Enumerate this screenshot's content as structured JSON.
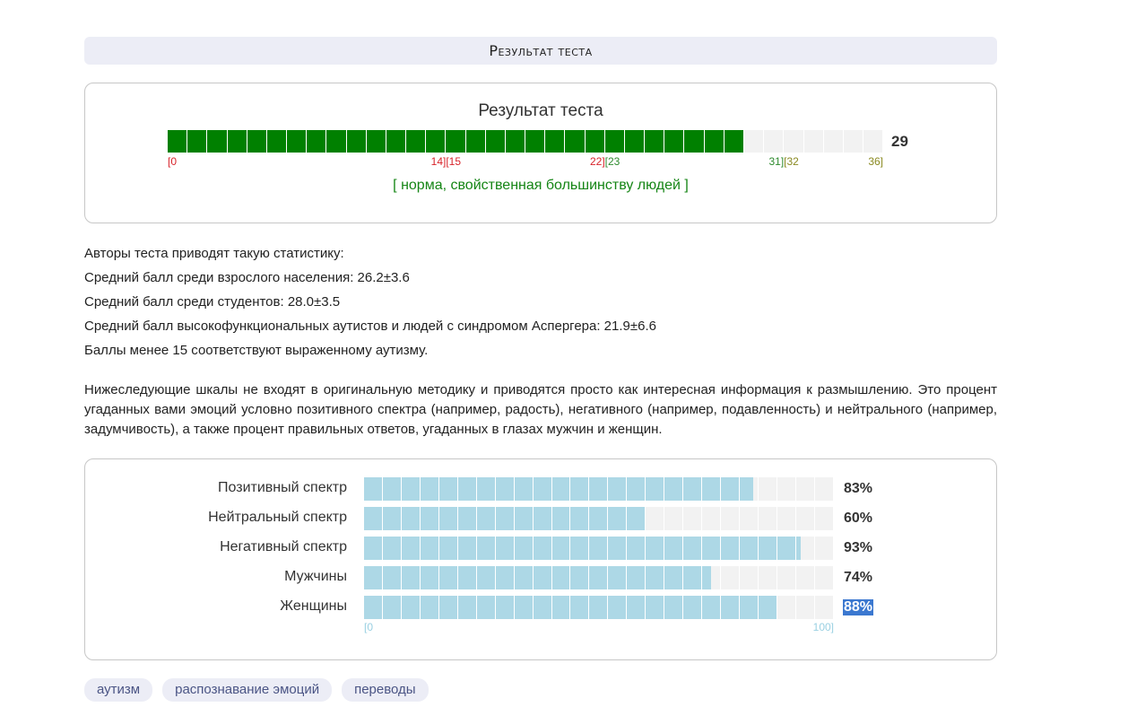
{
  "header": {
    "title": "Результат теста"
  },
  "main_result": {
    "title": "Результат теста",
    "value": 29,
    "max": 36,
    "value_label": "29",
    "fill_color": "#008000",
    "empty_color": "#f2f2f2",
    "ticks": [
      {
        "pos": 0,
        "text": "[0",
        "color": "#d8242b",
        "align": "left"
      },
      {
        "pos": 14,
        "text": "14]",
        "color": "#d8242b",
        "align": "right"
      },
      {
        "pos": 14,
        "text": "[15",
        "color": "#d8242b",
        "align": "left"
      },
      {
        "pos": 22,
        "text": "22]",
        "color": "#d8242b",
        "align": "right"
      },
      {
        "pos": 22,
        "text": "[23",
        "color": "#2e8b2e",
        "align": "left"
      },
      {
        "pos": 31,
        "text": "31]",
        "color": "#2e8b2e",
        "align": "right"
      },
      {
        "pos": 31,
        "text": "[32",
        "color": "#8a8a22",
        "align": "left"
      },
      {
        "pos": 36,
        "text": "36]",
        "color": "#8a8a22",
        "align": "right"
      }
    ],
    "verdict": "[ норма, свойственная большинству людей ]"
  },
  "stats": [
    "Авторы теста приводят такую статистику:",
    "Средний балл среди взрослого населения: 26.2±3.6",
    "Средний балл среди студентов: 28.0±3.5",
    "Средний балл высокофункциональных аутистов и людей с синдромом Аспергера: 21.9±6.6",
    "Баллы менее 15 соответствуют выраженному аутизму."
  ],
  "note": "Нижеследующие шкалы не входят в оригинальную методику и приводятся просто как интересная информация к размышлению. Это процент угаданных вами эмоций условно позитивного спектра (например, радость), негативного (например, подавленность) и нейтрального (например, задумчивость), а также процент правильных ответов, угаданных в глазах мужчин и женщин.",
  "scales": {
    "fill_color": "#add8e6",
    "empty_color": "#f2f2f2",
    "tick_min": "[0",
    "tick_max": "100]",
    "items": [
      {
        "label": "Позитивный спектр",
        "value": 83,
        "value_label": "83%",
        "selected": false
      },
      {
        "label": "Нейтральный спектр",
        "value": 60,
        "value_label": "60%",
        "selected": false
      },
      {
        "label": "Негативный спектр",
        "value": 93,
        "value_label": "93%",
        "selected": false
      },
      {
        "label": "Мужчины",
        "value": 74,
        "value_label": "74%",
        "selected": false
      },
      {
        "label": "Женщины",
        "value": 88,
        "value_label": "88%",
        "selected": true
      }
    ]
  },
  "tags": [
    "аутизм",
    "распознавание эмоций",
    "переводы"
  ]
}
